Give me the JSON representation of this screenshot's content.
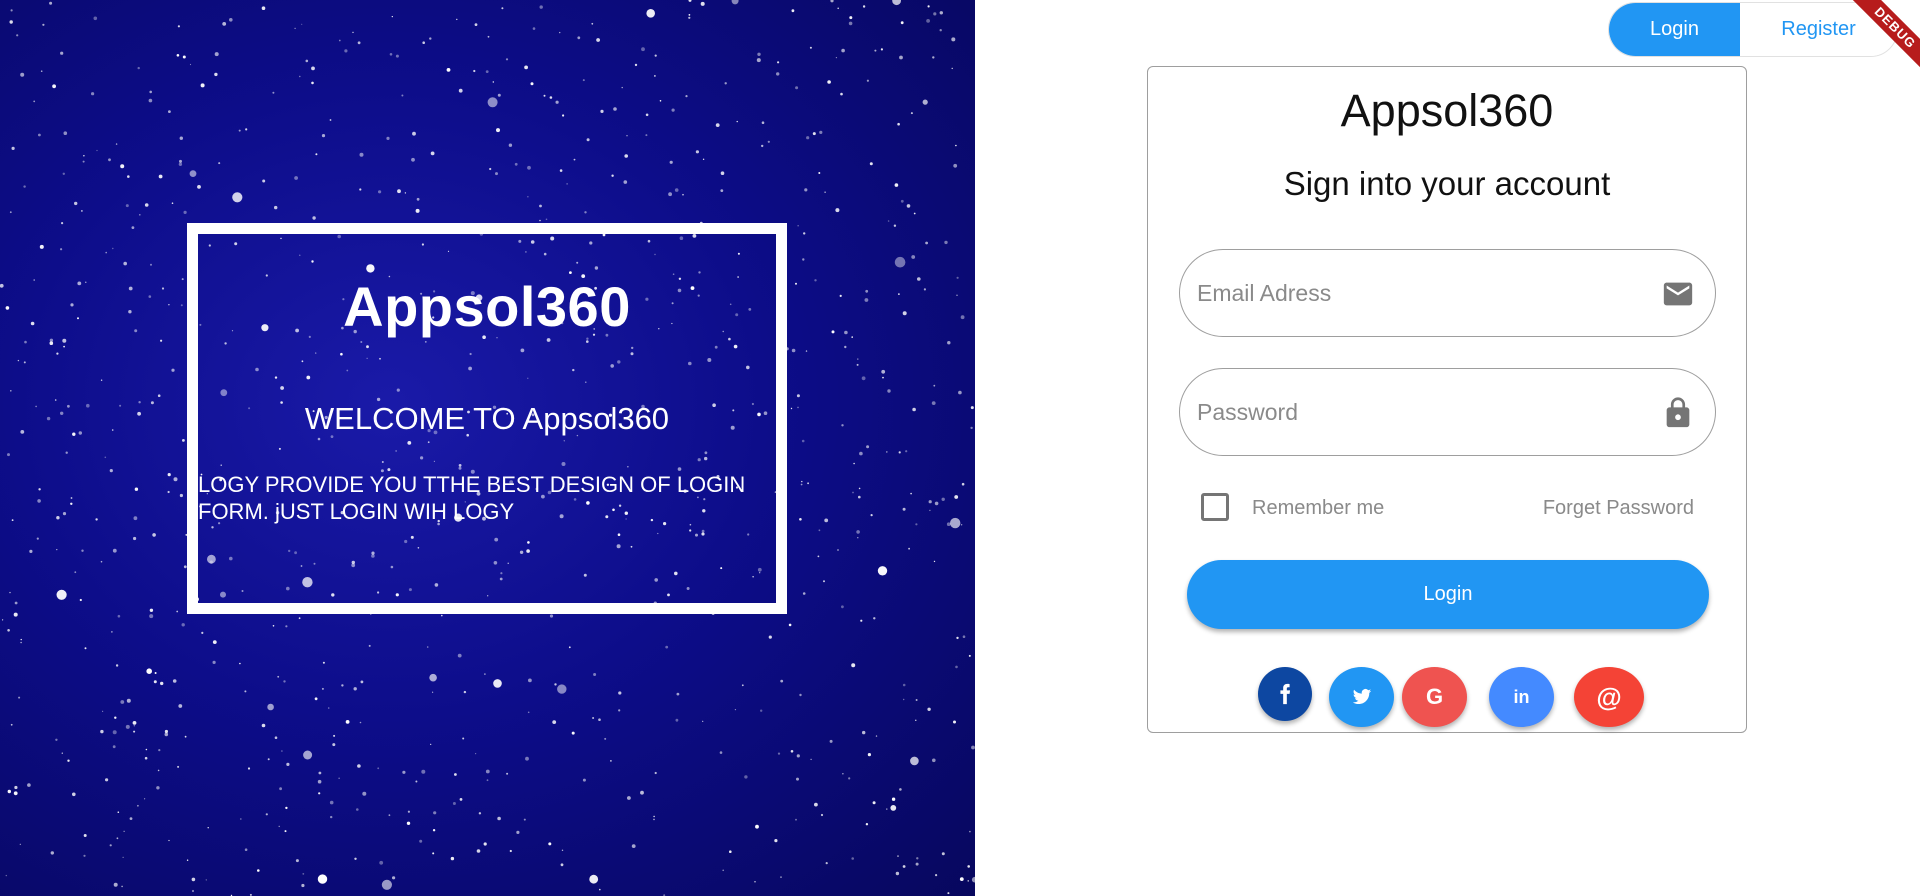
{
  "welcome_panel": {
    "title": "Appsol360",
    "subtitle": "WELCOME TO Appsol360",
    "description": "LOGY PROVIDE YOU TTHE BEST DESIGN OF LOGIN FORM. jUST LOGIN WIH LOGY"
  },
  "tabs": {
    "login": "Login",
    "register": "Register"
  },
  "debug_banner": "DEBUG",
  "form": {
    "title": "Appsol360",
    "subtitle": "Sign into your account",
    "email_placeholder": "Email Adress",
    "password_placeholder": "Password",
    "remember_label": "Remember me",
    "forget_label": "Forget Password",
    "login_button": "Login"
  },
  "social_buttons": [
    {
      "name": "facebook",
      "glyph": "f",
      "color": "#0d47a1"
    },
    {
      "name": "twitter",
      "glyph": "twitter-bird",
      "color": "#2196f3"
    },
    {
      "name": "google",
      "glyph": "G",
      "color": "#ef5350"
    },
    {
      "name": "linkedin",
      "glyph": "in",
      "color": "#448aff"
    },
    {
      "name": "email",
      "glyph": "@",
      "color": "#f44336"
    }
  ],
  "colors": {
    "accent": "#2196f3",
    "panel_bg": "#0d0d8a"
  }
}
